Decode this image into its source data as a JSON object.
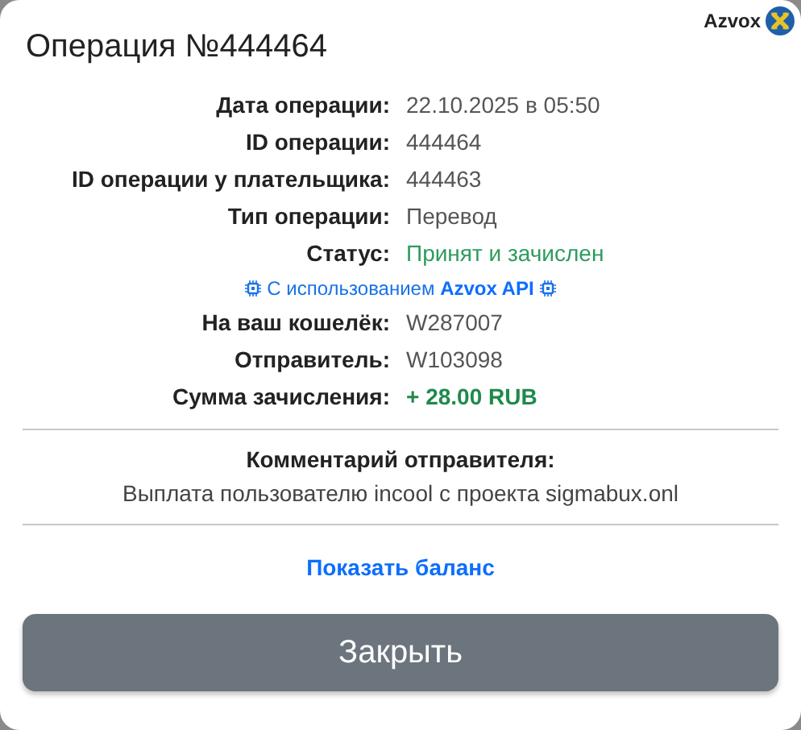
{
  "brand": {
    "name": "Azvox"
  },
  "title": "Операция №444464",
  "details": [
    {
      "kind": "field",
      "label": "Дата операции:",
      "value": "22.10.2025 в 05:50"
    },
    {
      "kind": "field",
      "label": "ID операции:",
      "value": "444464"
    },
    {
      "kind": "field",
      "label": "ID операции у плательщика:",
      "value": "444463"
    },
    {
      "kind": "field",
      "label": "Тип операции:",
      "value": "Перевод"
    },
    {
      "kind": "status",
      "label": "Статус:",
      "value": "Принят и зачислен"
    },
    {
      "kind": "note",
      "text": "С использованием **Azvox API**"
    },
    {
      "kind": "field",
      "label": "На ваш кошелёк:",
      "value": "W287007"
    },
    {
      "kind": "field",
      "label": "Отправитель:",
      "value": "W103098"
    },
    {
      "kind": "amount",
      "label": "Сумма зачисления:",
      "value": "+ 28.00 RUB"
    }
  ],
  "comment": {
    "label": "Комментарий отправителя:",
    "text": "Выплата пользователю incool с проекта sigmabux.onl"
  },
  "balance_link": "Показать баланс",
  "close_button": "Закрыть"
}
